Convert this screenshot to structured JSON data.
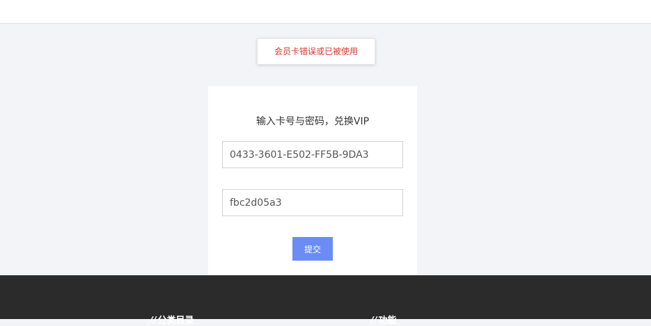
{
  "toast": {
    "message": "会员卡错误或已被使用"
  },
  "redeem": {
    "title": "输入卡号与密码，兑换VIP",
    "card_number_value": "0433-3601-E502-FF5B-9DA3",
    "password_value": "fbc2d05a3",
    "submit_label": "提交"
  },
  "footer": {
    "heading_mark": "//",
    "headings": [
      "分类目录",
      "功能"
    ]
  },
  "colors": {
    "accent": "#6b8cf5",
    "error": "#d9362e",
    "footer_bg": "#2b2b2b",
    "page_bg": "#f3f4f7"
  }
}
